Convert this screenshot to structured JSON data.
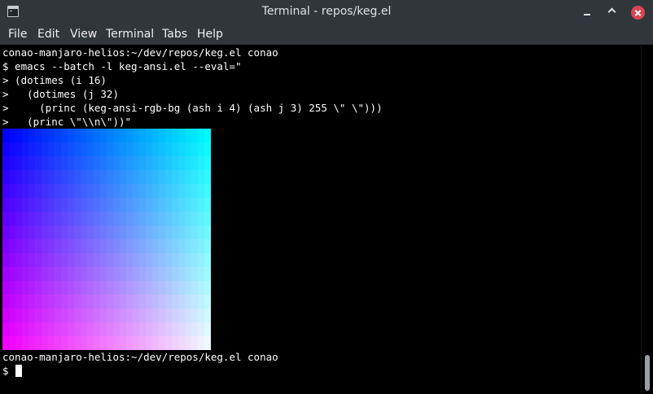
{
  "window": {
    "title": "Terminal - repos/keg.el"
  },
  "icons": {
    "app": "terminal-icon",
    "minimize": "minimize-icon",
    "maximize": "maximize-icon",
    "close": "close-icon"
  },
  "colors": {
    "titlebar_bg": "#31363b",
    "terminal_bg": "#000000",
    "terminal_fg": "#ffffff",
    "close_button": "#da4453"
  },
  "menu": {
    "file": "File",
    "edit": "Edit",
    "view": "View",
    "terminal": "Terminal",
    "tabs": "Tabs",
    "help": "Help"
  },
  "terminal": {
    "lines": [
      "conao-manjaro-helios:~/dev/repos/keg.el conao",
      "$ emacs --batch -l keg-ansi.el --eval=\"",
      "> (dotimes (i 16)",
      ">   (dotimes (j 32)",
      ">     (princ (keg-ansi-rgb-bg (ash i 4) (ash j 3) 255 \\\" \\\")))",
      ">   (princ \\\"\\\\n\\\"))\"",
      "conao-manjaro-helios:~/dev/repos/keg.el conao",
      "$ "
    ],
    "color_grid": {
      "rows": 16,
      "columns": 32,
      "red_step": 16,
      "green_step": 8,
      "blue": 255
    }
  }
}
